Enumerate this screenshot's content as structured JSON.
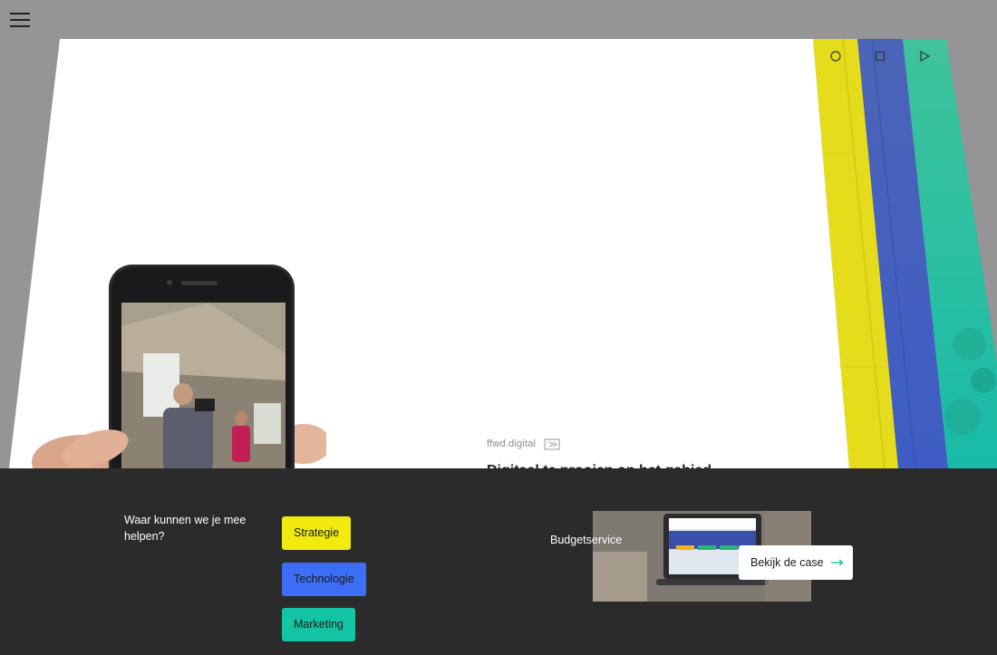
{
  "nav": {
    "menu_icon": "hamburger-icon"
  },
  "shapes": [
    {
      "name": "circle-shape-icon",
      "icon": "circle"
    },
    {
      "name": "square-shape-icon",
      "icon": "square"
    },
    {
      "name": "triangle-shape-icon",
      "icon": "play-triangle"
    }
  ],
  "card": {
    "brand": "ffwd.digital",
    "brand_icon": "brand-logo-icon",
    "title": "Digitaal te prooien op het gebied"
  },
  "help": {
    "question": "Waar kunnen we je mee helpen?",
    "tags": [
      {
        "label": "Strategie",
        "color": "#f1ea0d"
      },
      {
        "label": "Technologie",
        "color": "#3d6ff6"
      },
      {
        "label": "Marketing",
        "color": "#14c5a5"
      }
    ]
  },
  "case": {
    "title": "Budgetservice",
    "button_label": "Bekijk de case",
    "button_icon": "arrow-right-icon"
  },
  "colors": {
    "yellow": "#e8e020",
    "blue": "#3f5fc0",
    "teal": "#2fbf9c",
    "panel": "#2b2b2b",
    "accent_arrow": "#14c5a5"
  }
}
